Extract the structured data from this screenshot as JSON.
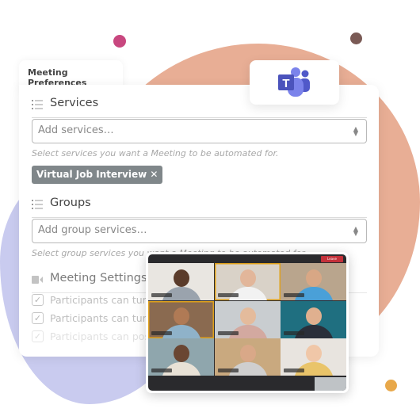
{
  "colors": {
    "peach": "#e8ae95",
    "lavender": "#c9cbef",
    "pink_dot": "#c8477f",
    "brown_dot": "#7a5a55",
    "orange_dot": "#e8a84a",
    "chip": "#80878a",
    "teams": "#5059c9",
    "leave": "#c4313a"
  },
  "tab": {
    "label": "Meeting Preferences"
  },
  "services": {
    "heading": "Services",
    "icon": "list-icon",
    "placeholder": "Add services…",
    "help": "Select services you want a Meeting to be automated for.",
    "chip": "Virtual Job Interview",
    "chip_remove": "✕"
  },
  "groups": {
    "heading": "Groups",
    "icon": "list-icon",
    "placeholder": "Add group services…",
    "help": "Select group services you want a Meeting to be automated for."
  },
  "meeting_settings": {
    "heading": "Meeting Settings",
    "icon": "video-camera-icon",
    "options": [
      {
        "label": "Participants can turn",
        "checked": true
      },
      {
        "label": "Participants can turn",
        "checked": true
      },
      {
        "label": "Participants can post",
        "checked": true
      }
    ]
  },
  "teams_logo": {
    "icon": "microsoft-teams-icon",
    "letter": "T"
  },
  "video_call": {
    "leave_label": "Leave",
    "tiles": [
      {
        "bg": "#e9e6e1",
        "skin": "#5a3b2a",
        "shirt": "#9aa3ad",
        "selected": false
      },
      {
        "bg": "#d9d2c8",
        "skin": "#e2b69a",
        "shirt": "#f2f2f2",
        "selected": true
      },
      {
        "bg": "#b9a58d",
        "skin": "#d8a785",
        "shirt": "#4aa0d8",
        "selected": false
      },
      {
        "bg": "#8a6a50",
        "skin": "#b07a55",
        "shirt": "#8fb2c9",
        "selected": true
      },
      {
        "bg": "#c9cdd0",
        "skin": "#e4bb9c",
        "shirt": "#d3a9a0",
        "selected": false
      },
      {
        "bg": "#1f6f80",
        "skin": "#e0b08f",
        "shirt": "#2a2f3a",
        "selected": false
      },
      {
        "bg": "#8fa6ad",
        "skin": "#6a4632",
        "shirt": "#e8e1d6",
        "selected": false
      },
      {
        "bg": "#c9a97f",
        "skin": "#d9a888",
        "shirt": "#cfcfcf",
        "selected": false
      },
      {
        "bg": "#e8e4df",
        "skin": "#f0c7a8",
        "shirt": "#e9c46a",
        "selected": false
      }
    ]
  }
}
